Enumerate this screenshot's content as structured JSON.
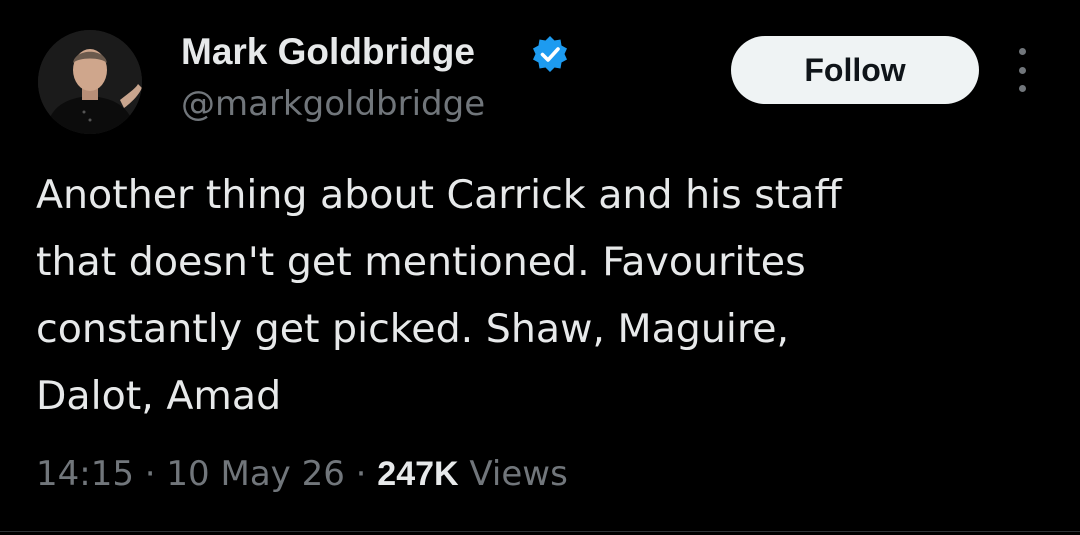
{
  "author": {
    "display_name": "Mark Goldbridge",
    "handle": "@markgoldbridge",
    "verified": true,
    "verified_icon": "verified-badge-icon",
    "verified_color": "#1d9bf0"
  },
  "actions": {
    "follow_label": "Follow",
    "more_icon": "more-vertical-icon"
  },
  "tweet": {
    "lines": [
      "Another thing about Carrick and his staff",
      "that doesn't get mentioned. Favourites",
      "constantly get picked. Shaw, Maguire,",
      "Dalot, Amad"
    ]
  },
  "meta": {
    "time": "14:15",
    "separator": "·",
    "date": "10 May 26",
    "views_count": "247K",
    "views_label": "Views"
  },
  "colors": {
    "background": "#000000",
    "text": "#e7e9ea",
    "muted": "#71767b",
    "follow_bg": "#eff3f4"
  }
}
